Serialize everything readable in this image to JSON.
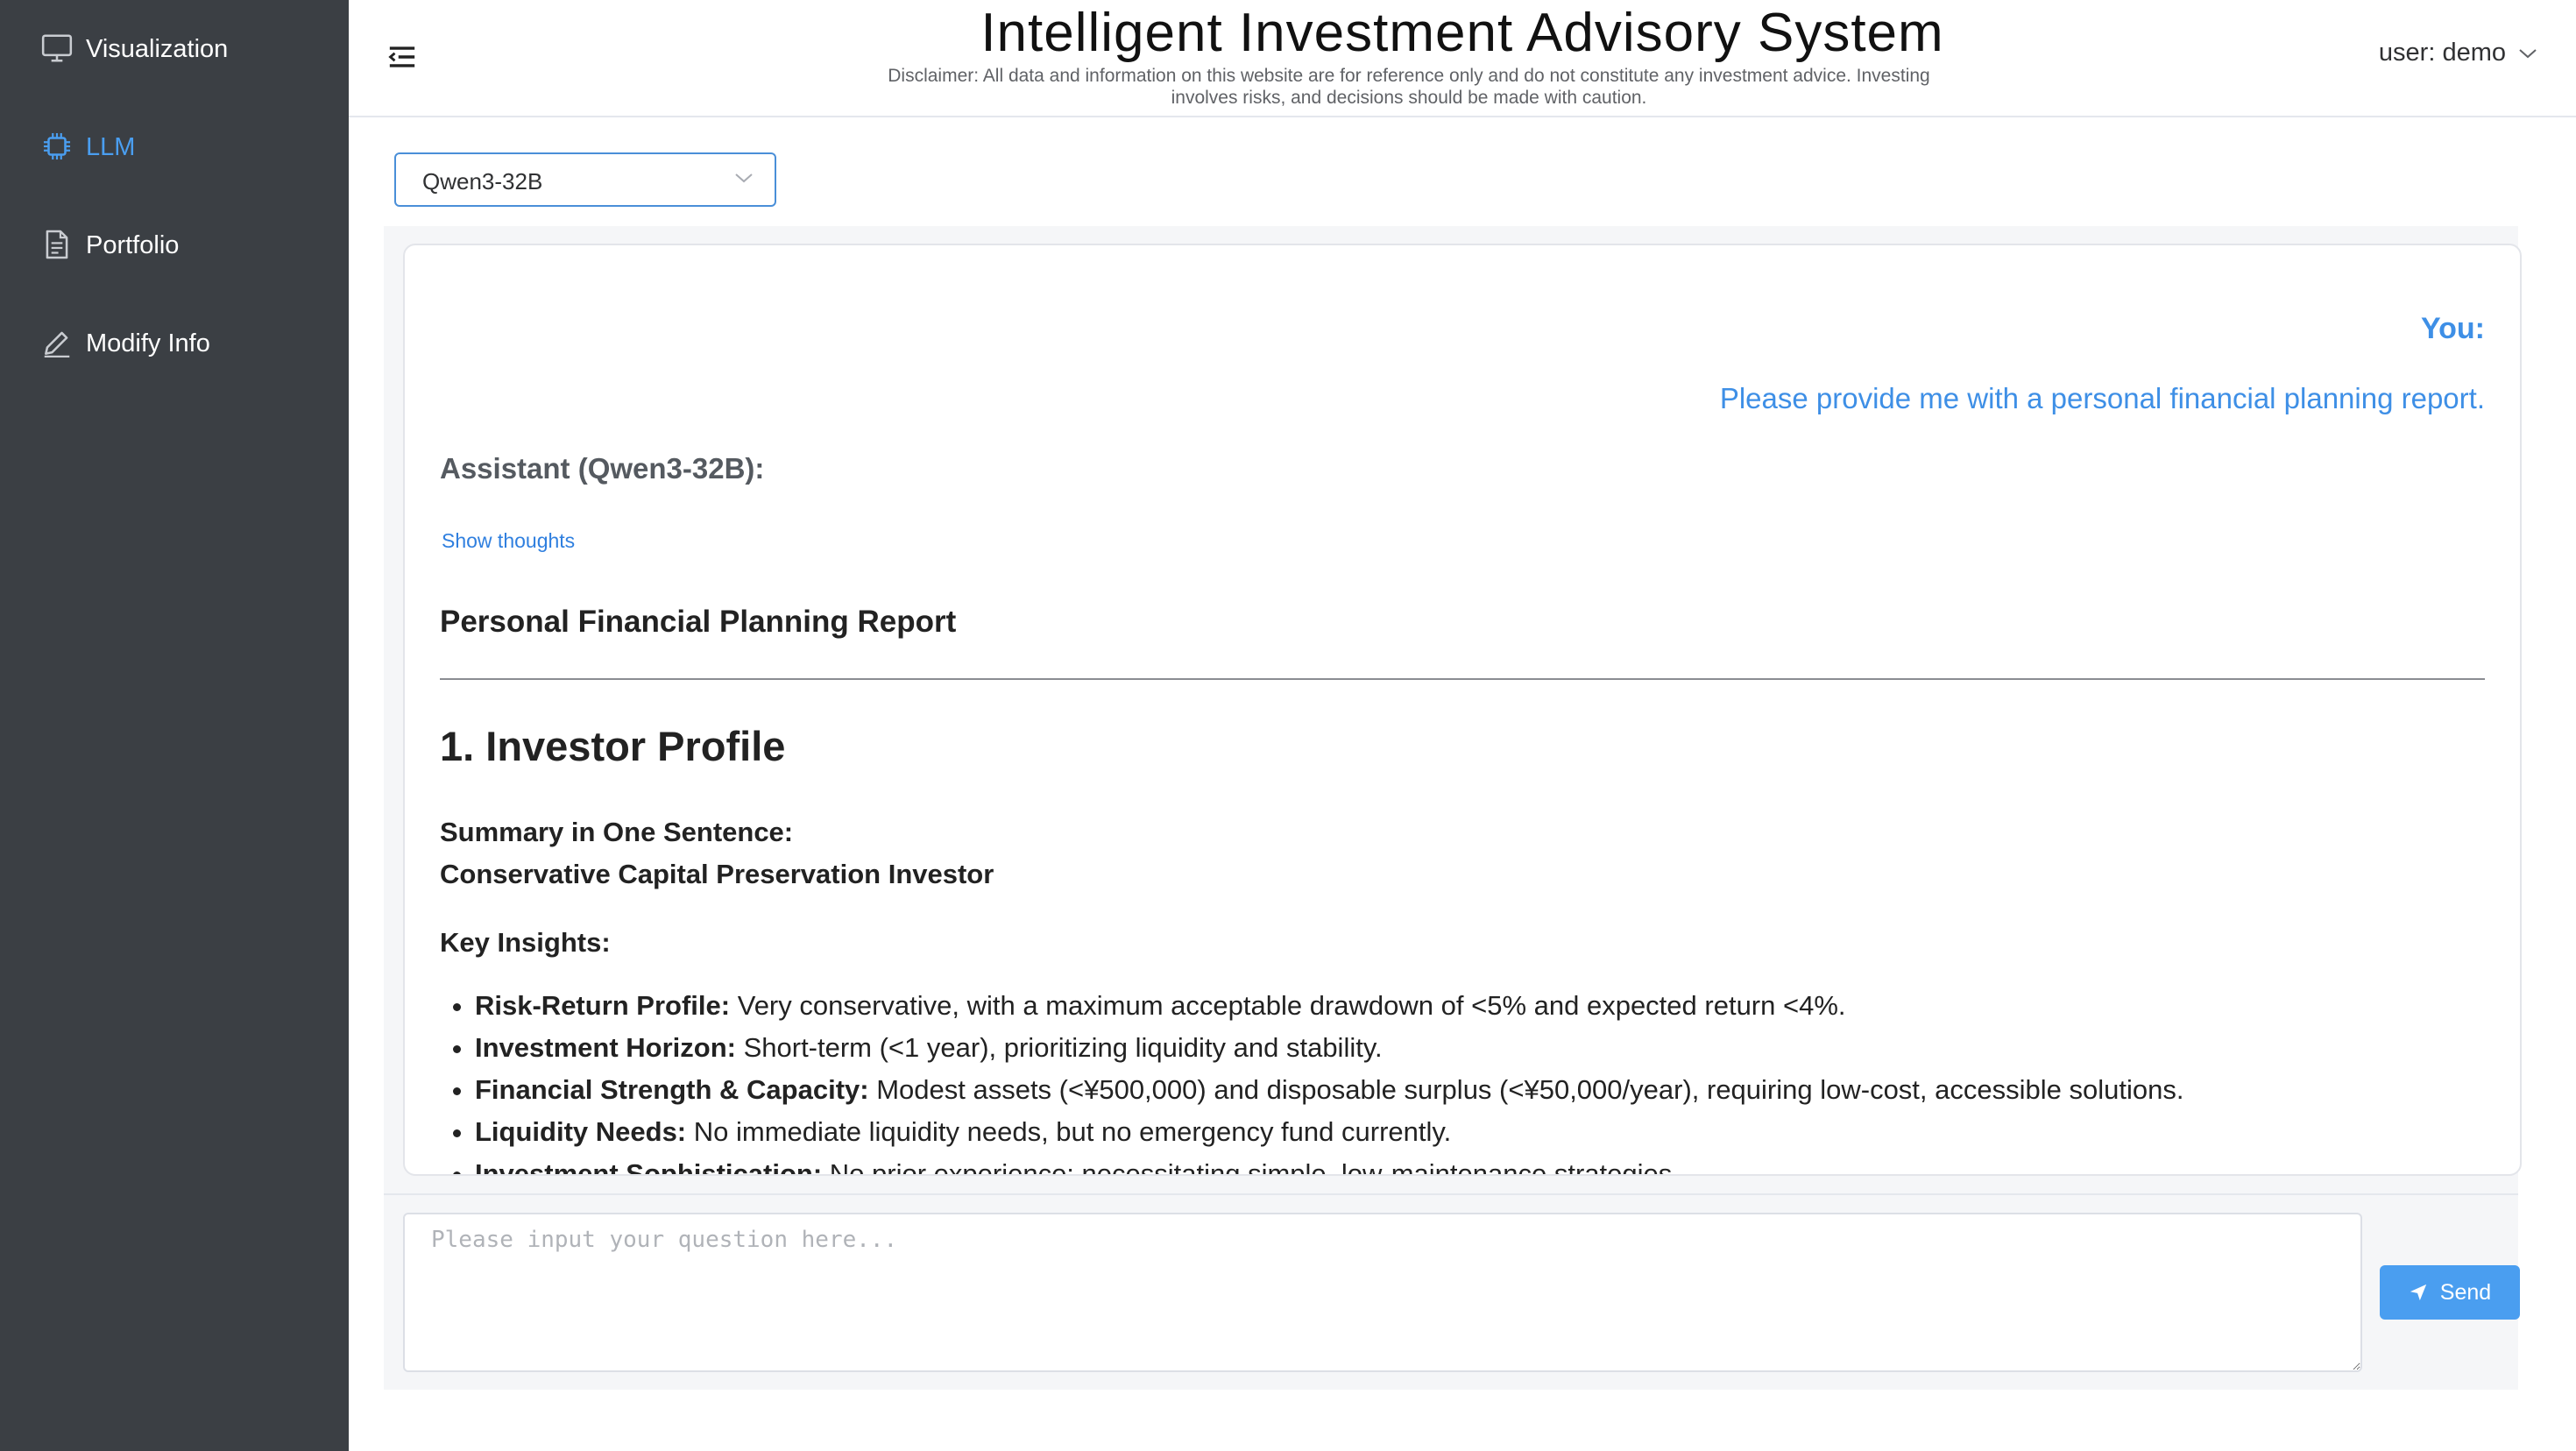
{
  "app": {
    "title": "Intelligent Investment Advisory System",
    "disclaimer": "Disclaimer: All data and information on this website are for reference only and do not constitute any investment advice. Investing involves risks, and decisions should be made with caution."
  },
  "sidebar": {
    "items": [
      {
        "label": "Visualization",
        "icon": "monitor-icon",
        "active": false
      },
      {
        "label": "LLM",
        "icon": "chip-icon",
        "active": true
      },
      {
        "label": "Portfolio",
        "icon": "document-icon",
        "active": false
      },
      {
        "label": "Modify Info",
        "icon": "edit-icon",
        "active": false
      }
    ]
  },
  "header": {
    "user_label": "user: demo"
  },
  "model_select": {
    "value": "Qwen3-32B"
  },
  "chat": {
    "you_label": "You:",
    "you_message": "Please provide me with a personal financial planning report.",
    "assistant_label": "Assistant (Qwen3-32B):",
    "show_thoughts": "Show thoughts",
    "report": {
      "title": "Personal Financial Planning Report",
      "section_heading": "1. Investor Profile",
      "summary_label": "Summary in One Sentence:",
      "summary_value": "Conservative Capital Preservation Investor",
      "insights_label": "Key Insights:",
      "insights": [
        {
          "term": "Risk-Return Profile:",
          "text": " Very conservative, with a maximum acceptable drawdown of <5% and expected return <4%."
        },
        {
          "term": "Investment Horizon:",
          "text": " Short-term (<1 year), prioritizing liquidity and stability."
        },
        {
          "term": "Financial Strength & Capacity:",
          "text": " Modest assets (<¥500,000) and disposable surplus (<¥50,000/year), requiring low-cost, accessible solutions."
        },
        {
          "term": "Liquidity Needs:",
          "text": " No immediate liquidity needs, but no emergency fund currently."
        },
        {
          "term": "Investment Sophistication:",
          "text": " No prior experience; necessitating simple, low-maintenance strategies."
        }
      ]
    }
  },
  "input": {
    "placeholder": "Please input your question here...",
    "send_label": "Send"
  },
  "colors": {
    "sidebar_bg": "#3b3f44",
    "accent": "#4a9ef0"
  }
}
